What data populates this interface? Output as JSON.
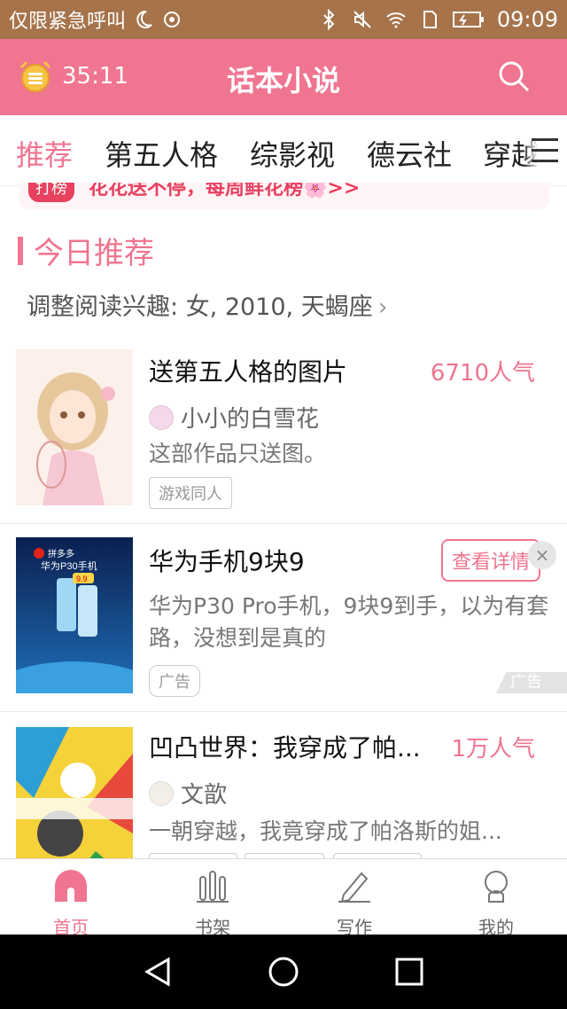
{
  "status_bar": {
    "carrier_text": "仅限紧急呼叫",
    "time": "09:09",
    "icons": [
      "moon-icon",
      "hotspot-icon",
      "bluetooth-icon",
      "mute-icon",
      "wifi-icon",
      "sim-icon",
      "battery-icon"
    ]
  },
  "app_bar": {
    "timer": "35:11",
    "title": "话本小说",
    "timer_icon": "alarm-clock-icon",
    "search_icon": "search-icon"
  },
  "tabs": [
    {
      "label": "推荐",
      "active": true
    },
    {
      "label": "第五人格",
      "active": false
    },
    {
      "label": "综影视",
      "active": false
    },
    {
      "label": "德云社",
      "active": false
    },
    {
      "label": "穿越",
      "active": false
    }
  ],
  "promo": {
    "badge": "打榜",
    "text": "花花送不停，每周鲜花榜🌸>>"
  },
  "section": {
    "title": "今日推荐",
    "interest_text": "调整阅读兴趣: 女, 2010, 天蝎座",
    "interest_chevron": "›"
  },
  "items": [
    {
      "title": "送第五人格的图片",
      "popularity": "6710人气",
      "author": "小小的白雪花",
      "description": "这部作品只送图。",
      "tags": [
        "游戏同人"
      ]
    },
    {
      "title": "华为手机9块9",
      "cta": "查看详情",
      "description": "华为P30 Pro手机，9块9到手，以为有套路，没想到是真的",
      "tags": [
        "广告"
      ],
      "ad_label": "广告",
      "close": "×",
      "thumb_brand": "拼多多",
      "thumb_caption": "华为P30手机",
      "thumb_price": "9.9"
    },
    {
      "title": "凹凸世界：我穿成了帕...",
      "popularity": "1万人气",
      "author": "文歆",
      "description": "一朝穿越，我竟穿成了帕洛斯的姐...",
      "tags": [
        "",
        "",
        ""
      ]
    }
  ],
  "bottom_nav": [
    {
      "label": "首页",
      "icon": "home-icon",
      "active": true
    },
    {
      "label": "书架",
      "icon": "bookshelf-icon",
      "active": false
    },
    {
      "label": "写作",
      "icon": "pen-icon",
      "active": false
    },
    {
      "label": "我的",
      "icon": "profile-icon",
      "active": false
    }
  ],
  "system_nav": [
    "back-icon",
    "home-circle-icon",
    "recents-icon"
  ],
  "colors": {
    "accent": "#f07590",
    "status_bar": "#a6734a",
    "promo_red": "#e8405f"
  }
}
